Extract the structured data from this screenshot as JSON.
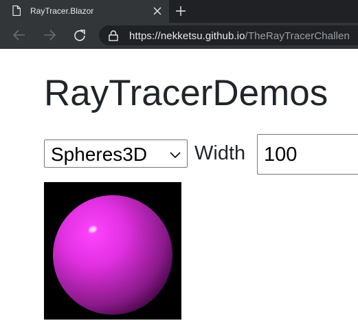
{
  "browser": {
    "tab_title": "RayTracer.Blazor",
    "url_host": "https://nekketsu.github.io",
    "url_path": "/TheRayTracerChallen",
    "icons": [
      "page-icon",
      "close-icon",
      "plus-icon",
      "back-arrow-icon",
      "forward-arrow-icon",
      "reload-icon",
      "lock-icon"
    ]
  },
  "page": {
    "title": "RayTracerDemos",
    "demo_select": {
      "selected": "Spheres3D"
    },
    "width_label": "Width",
    "width_value": "100"
  },
  "render": {
    "sphere_colors": {
      "highlight": "#ffffff",
      "light": "#ff44ff",
      "base": "#c020c0",
      "dark": "#3a003a"
    },
    "background": "#000000"
  }
}
